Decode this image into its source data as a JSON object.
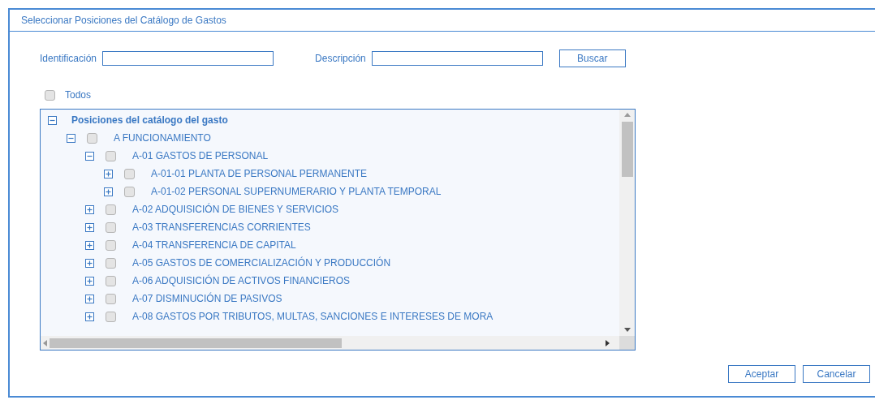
{
  "dialog": {
    "title": "Seleccionar Posiciones del Catálogo de Gastos"
  },
  "search": {
    "fields": [
      {
        "label": "Identificación"
      },
      {
        "label": "Descripción"
      }
    ],
    "button": "Buscar"
  },
  "select_all": {
    "label": "Todos",
    "checked": false
  },
  "tree": {
    "label": "Posiciones del catálogo del gasto",
    "expanded": true,
    "children": [
      {
        "label": "A FUNCIONAMIENTO",
        "expanded": true,
        "checked": false,
        "children": [
          {
            "label": "A-01 GASTOS DE PERSONAL",
            "expanded": true,
            "checked": false,
            "children": [
              {
                "label": "A-01-01 PLANTA DE PERSONAL PERMANENTE",
                "expanded": false,
                "checked": false
              },
              {
                "label": "A-01-02 PERSONAL SUPERNUMERARIO Y PLANTA TEMPORAL",
                "expanded": false,
                "checked": false
              }
            ]
          },
          {
            "label": "A-02 ADQUISICIÓN DE BIENES Y SERVICIOS",
            "expanded": false,
            "checked": false
          },
          {
            "label": "A-03 TRANSFERENCIAS CORRIENTES",
            "expanded": false,
            "checked": false
          },
          {
            "label": "A-04 TRANSFERENCIA DE CAPITAL",
            "expanded": false,
            "checked": false
          },
          {
            "label": "A-05 GASTOS DE COMERCIALIZACIÓN Y PRODUCCIÓN",
            "expanded": false,
            "checked": false
          },
          {
            "label": "A-06 ADQUISICIÓN DE ACTIVOS FINANCIEROS",
            "expanded": false,
            "checked": false
          },
          {
            "label": "A-07 DISMINUCIÓN DE PASIVOS",
            "expanded": false,
            "checked": false
          },
          {
            "label": "A-08 GASTOS POR TRIBUTOS, MULTAS, SANCIONES E INTERESES DE MORA",
            "expanded": false,
            "checked": false
          }
        ]
      }
    ]
  },
  "buttons": [
    "Aceptar",
    "Cancelar"
  ]
}
